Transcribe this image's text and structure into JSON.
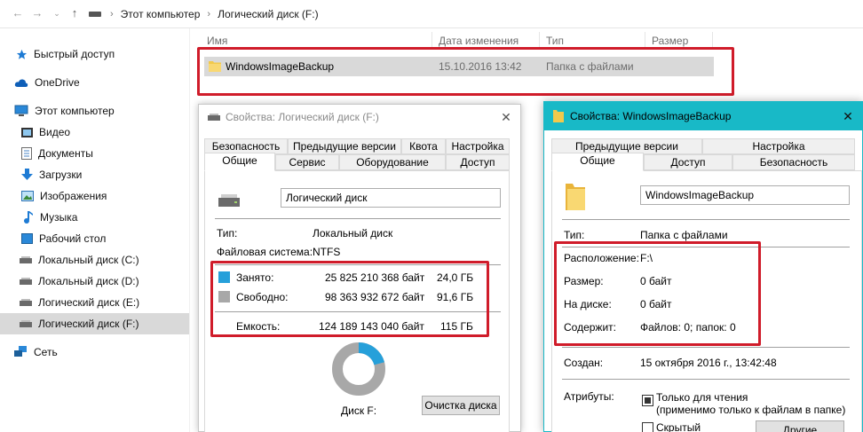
{
  "explorer": {
    "breadcrumb": [
      "Этот компьютер",
      "Логический диск (F:)"
    ],
    "nav": {
      "quick_access": "Быстрый доступ",
      "onedrive": "OneDrive",
      "this_pc": "Этот компьютер",
      "video": "Видео",
      "documents": "Документы",
      "downloads": "Загрузки",
      "images": "Изображения",
      "music": "Музыка",
      "desktop": "Рабочий стол",
      "disk_c": "Локальный диск (C:)",
      "disk_d": "Локальный диск (D:)",
      "disk_e": "Логический диск (E:)",
      "disk_f": "Логический диск (F:)",
      "network": "Сеть"
    },
    "columns": {
      "name": "Имя",
      "date": "Дата изменения",
      "type": "Тип",
      "size": "Размер"
    },
    "file": {
      "name": "WindowsImageBackup",
      "date": "15.10.2016 13:42",
      "type": "Папка с файлами"
    }
  },
  "disk_dialog": {
    "title": "Свойства: Логический диск (F:)",
    "tabs_row1": [
      "Безопасность",
      "Предыдущие версии",
      "Квота",
      "Настройка"
    ],
    "tabs_row2": [
      "Общие",
      "Сервис",
      "Оборудование",
      "Доступ"
    ],
    "name_value": "Логический диск",
    "type_label": "Тип:",
    "type_value": "Локальный диск",
    "fs_label": "Файловая система:",
    "fs_value": "NTFS",
    "used_label": "Занято:",
    "used_bytes": "25 825 210 368 байт",
    "used_gb": "24,0 ГБ",
    "free_label": "Свободно:",
    "free_bytes": "98 363 932 672 байт",
    "free_gb": "91,6 ГБ",
    "cap_label": "Емкость:",
    "cap_bytes": "124 189 143 040 байт",
    "cap_gb": "115 ГБ",
    "used_fraction": 0.208,
    "used_color": "#26a0da",
    "free_color": "#a8a8a8",
    "disk_label": "Диск F:",
    "cleanup_button": "Очистка диска"
  },
  "folder_dialog": {
    "title": "Свойства: WindowsImageBackup",
    "tabs_row1": [
      "Предыдущие версии",
      "Настройка"
    ],
    "tabs_row2": [
      "Общие",
      "Доступ",
      "Безопасность"
    ],
    "name_value": "WindowsImageBackup",
    "type_label": "Тип:",
    "type_value": "Папка с файлами",
    "location_label": "Расположение:",
    "location_value": "F:\\",
    "size_label": "Размер:",
    "size_value": "0 байт",
    "ondisk_label": "На диске:",
    "ondisk_value": "0 байт",
    "contains_label": "Содержит:",
    "contains_value": "Файлов: 0; папок: 0",
    "created_label": "Создан:",
    "created_value": "15 октября 2016 г., 13:42:48",
    "attributes_label": "Атрибуты:",
    "readonly_label": "Только для чтения",
    "readonly_note": "(применимо только к файлам в папке)",
    "hidden_label": "Скрытый",
    "other_button": "Другие"
  },
  "highlight_color": "#d01c2a"
}
